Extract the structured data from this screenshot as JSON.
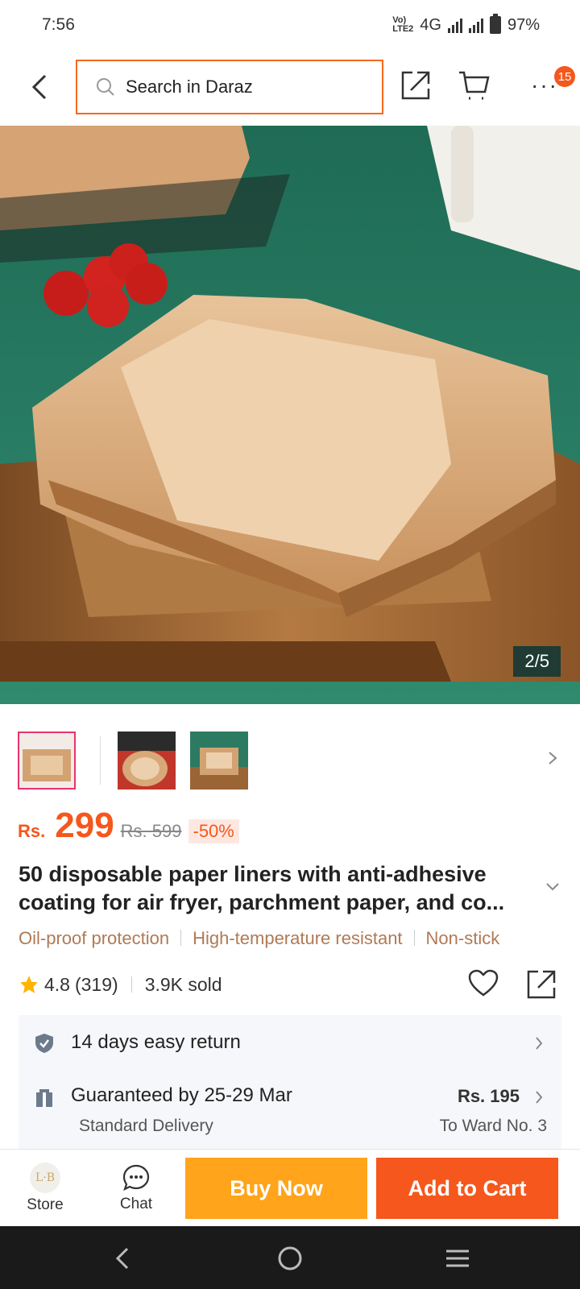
{
  "status": {
    "time": "7:56",
    "network": "Vo LTE2 4G",
    "battery": "97%"
  },
  "header": {
    "search_placeholder": "Search in Daraz",
    "cart_badge": "15"
  },
  "gallery": {
    "counter": "2/5"
  },
  "price": {
    "currency": "Rs.",
    "current": "299",
    "original": "Rs. 599",
    "discount": "-50%"
  },
  "product": {
    "title": "50 disposable paper liners with anti-adhesive coating for air fryer, parchment paper, and co..."
  },
  "tags": [
    "Oil-proof protection",
    "High-temperature resistant",
    "Non-stick"
  ],
  "rating": {
    "score": "4.8",
    "count": "(319)",
    "sold": "3.9K sold"
  },
  "return": {
    "label": "14 days easy return"
  },
  "delivery": {
    "label": "Guaranteed by 25-29 Mar",
    "type": "Standard Delivery",
    "price": "Rs. 195",
    "location": "To Ward No. 3"
  },
  "bottom": {
    "store_label": "Store",
    "chat_label": "Chat",
    "buy_now": "Buy Now",
    "add_to_cart": "Add to Cart",
    "logo_text": "L·B"
  },
  "colors": {
    "brand_orange": "#f5571d",
    "buy_yellow": "#ffa41b",
    "search_border": "#f36a1c"
  }
}
